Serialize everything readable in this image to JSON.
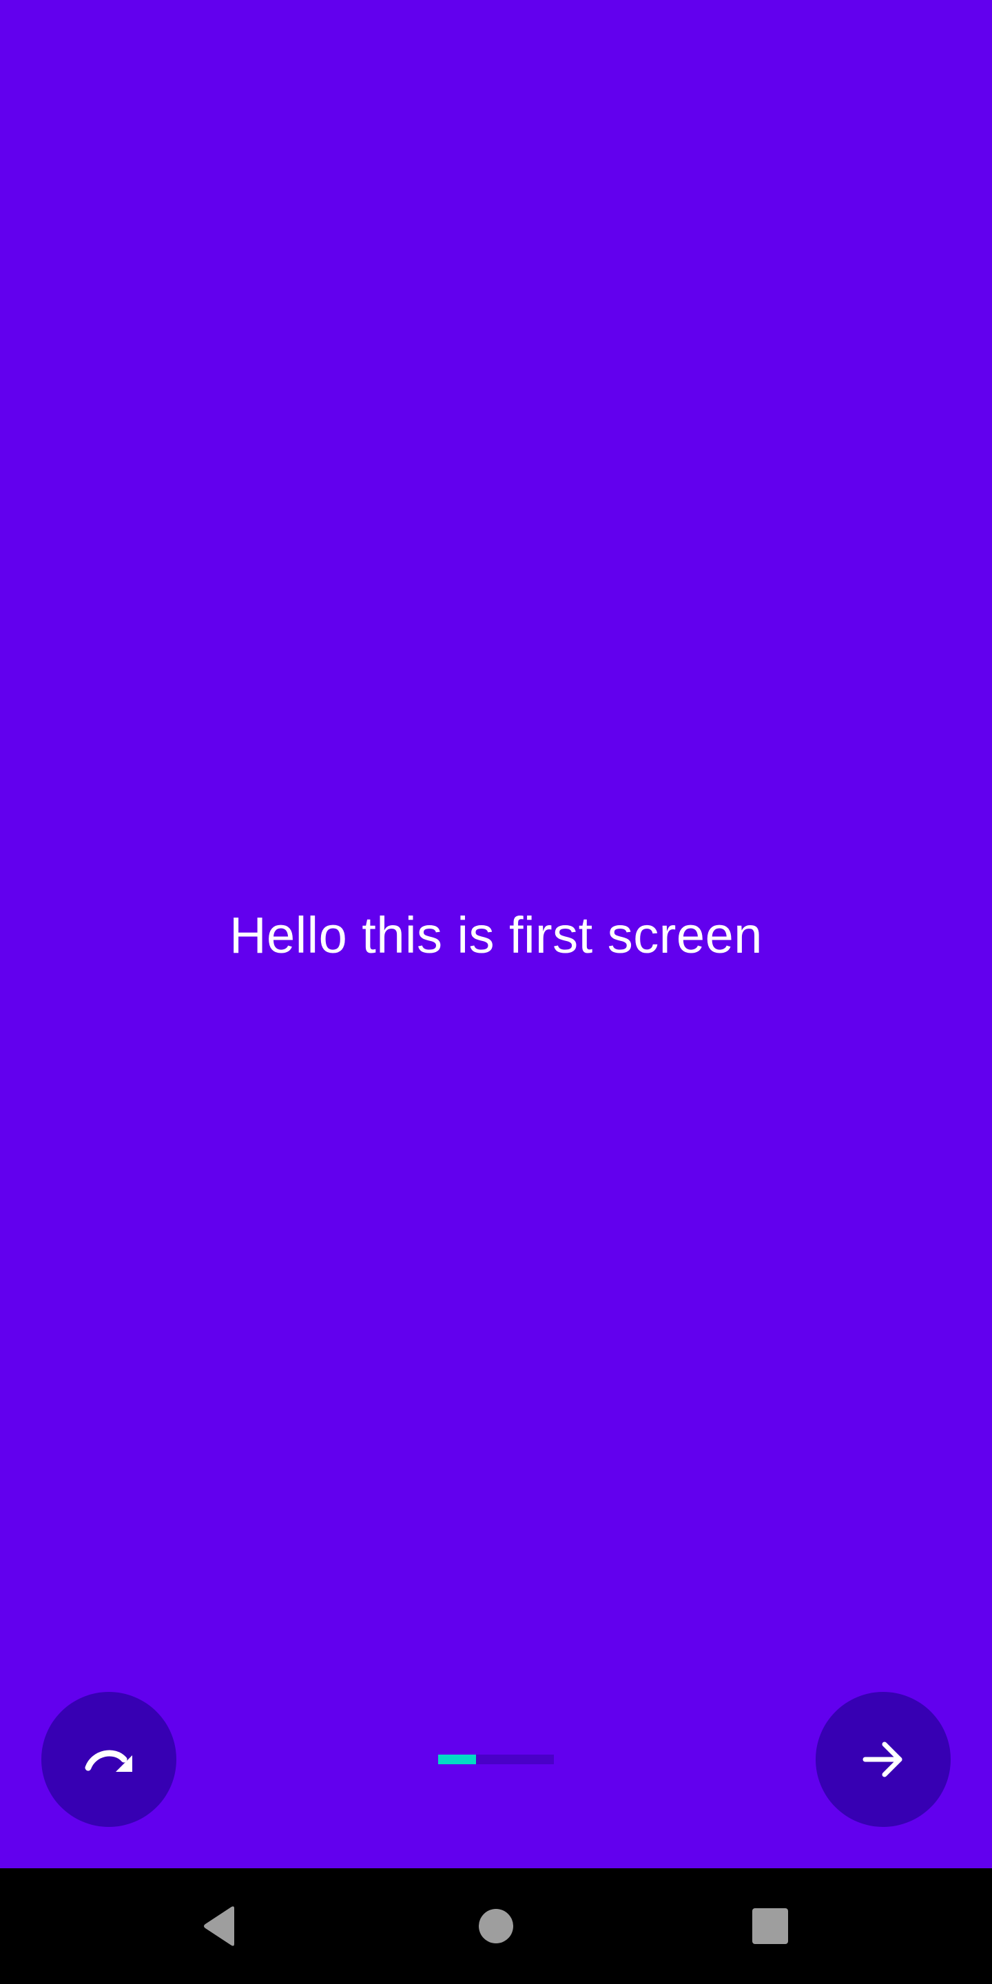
{
  "screen": {
    "headline": "Hello this is first screen",
    "background_color": "#6200EE"
  },
  "controls": {
    "skip_icon": "redo-arrow-icon",
    "next_icon": "arrow-right-icon",
    "fab_color": "#3700B3"
  },
  "progress": {
    "fraction": 0.33,
    "fill_color": "#03DAC5",
    "track_color": "#4A00C8"
  },
  "system_nav": {
    "back_icon": "back-triangle-icon",
    "home_icon": "home-circle-icon",
    "recents_icon": "recents-square-icon"
  }
}
